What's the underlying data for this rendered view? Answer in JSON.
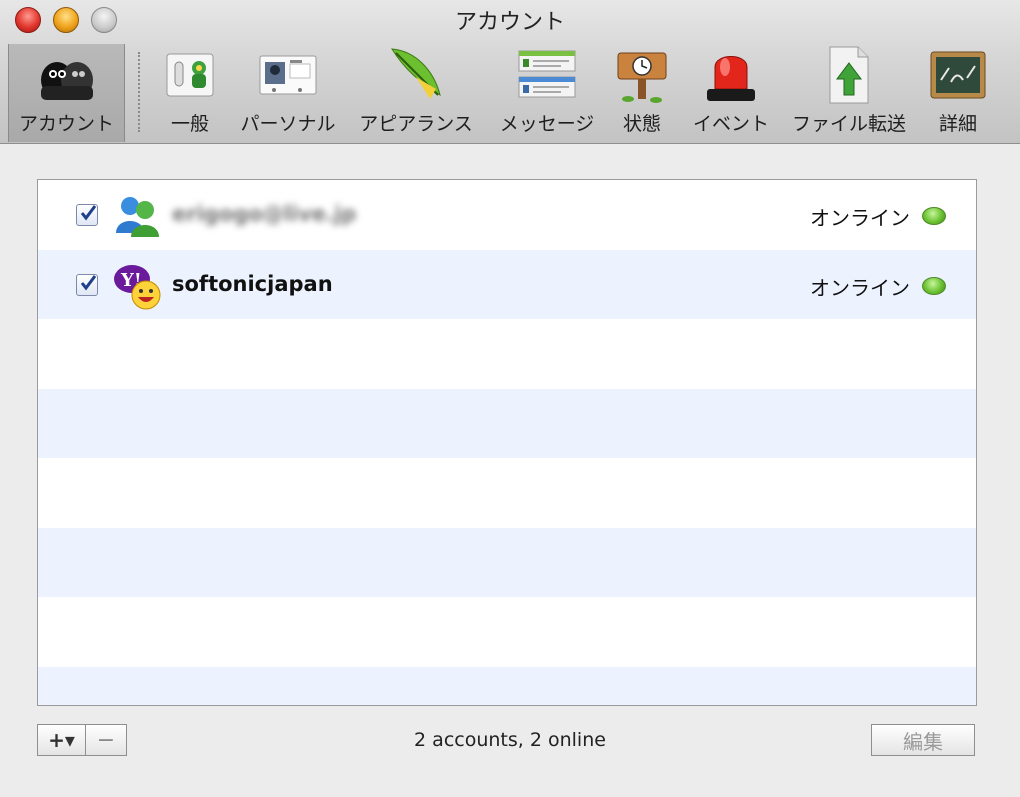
{
  "window": {
    "title": "アカウント"
  },
  "toolbar": {
    "items": [
      {
        "label": "アカウント",
        "icon": "accounts-icon",
        "selected": true
      },
      {
        "label": "一般",
        "icon": "general-icon"
      },
      {
        "label": "パーソナル",
        "icon": "personal-icon"
      },
      {
        "label": "アピアランス",
        "icon": "appearance-icon"
      },
      {
        "label": "メッセージ",
        "icon": "messages-icon"
      },
      {
        "label": "状態",
        "icon": "status-icon"
      },
      {
        "label": "イベント",
        "icon": "events-icon"
      },
      {
        "label": "ファイル転送",
        "icon": "file-transfer-icon"
      },
      {
        "label": "詳細",
        "icon": "advanced-icon"
      }
    ]
  },
  "accounts": [
    {
      "name": "erigogo@live.jp",
      "enabled": true,
      "service_icon": "msn-messenger-icon",
      "status": "オンライン",
      "status_color": "#6bc132"
    },
    {
      "name": "softonicjapan",
      "enabled": true,
      "service_icon": "yahoo-messenger-icon",
      "status": "オンライン",
      "status_color": "#6bc132"
    }
  ],
  "footer": {
    "add_label": "+▾",
    "remove_label": "−",
    "summary": "2 accounts, 2 online",
    "edit_label": "編集"
  }
}
